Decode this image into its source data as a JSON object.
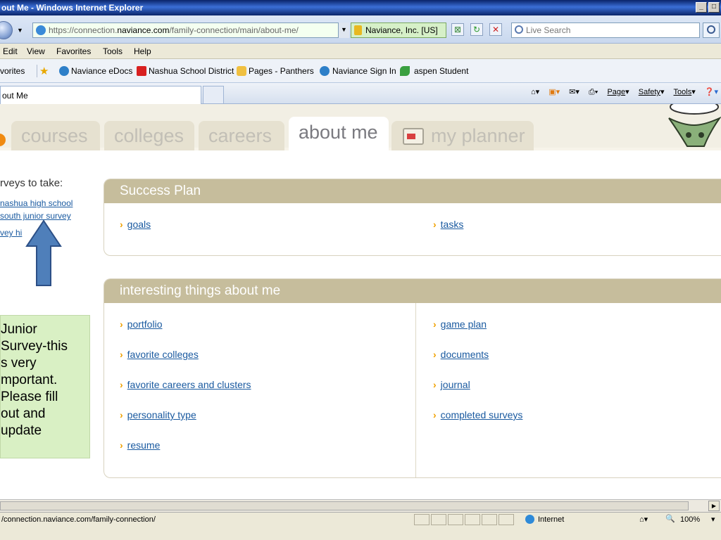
{
  "window": {
    "title": "out Me - Windows Internet Explorer"
  },
  "address": {
    "prefix": "https://",
    "host_pre": "connection.",
    "host": "naviance.com",
    "path": "/family-connection/main/about-me/",
    "cert": "Naviance, Inc. [US]",
    "search_placeholder": "Live Search"
  },
  "menu": [
    "Edit",
    "View",
    "Favorites",
    "Tools",
    "Help"
  ],
  "favorites": {
    "label": "vorites",
    "items": [
      "Naviance eDocs",
      "Nashua School District",
      "Pages - Panthers",
      "Naviance Sign In",
      "aspen Student"
    ]
  },
  "tab": {
    "title": "out Me"
  },
  "commandbar": [
    "Page",
    "Safety",
    "Tools"
  ],
  "nav": {
    "tabs": [
      "courses",
      "colleges",
      "careers",
      "about me",
      "my planner"
    ],
    "active": "about me"
  },
  "surveys": {
    "title": "rveys to take:",
    "links": [
      "nashua high school",
      "south junior survey",
      "vey hi"
    ]
  },
  "success_plan": {
    "title": "Success Plan",
    "left": [
      "goals"
    ],
    "right": [
      "tasks"
    ]
  },
  "interesting": {
    "title": "interesting things about me",
    "left": [
      "portfolio",
      "favorite colleges",
      "favorite careers and clusters",
      "personality type",
      "resume"
    ],
    "right": [
      "game plan",
      "documents",
      "journal",
      "completed surveys"
    ]
  },
  "callout": {
    "text": "Junior\nSurvey-this\ns very\nmportant.\nPlease fill\nout and\nupdate"
  },
  "status": {
    "url": "/connection.naviance.com/family-connection/",
    "zone": "Internet",
    "zoom": "100%"
  },
  "colors": {
    "panel_header": "#c6bd9c",
    "link": "#1a5aa0",
    "chevron": "#f0a000",
    "callout_bg": "#d9f0c4",
    "arrow": "#4f7fba"
  }
}
